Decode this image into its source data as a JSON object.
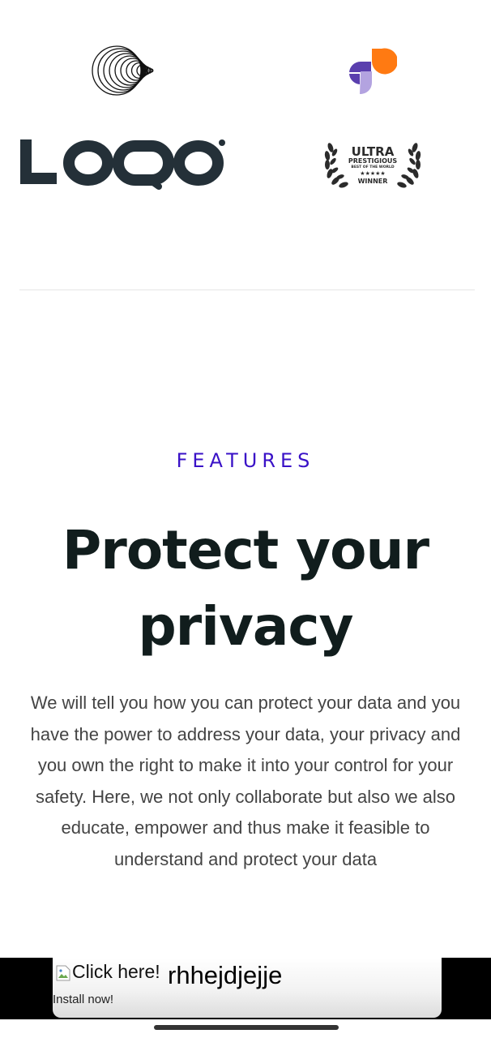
{
  "logos": [
    {
      "name": "concentric-circles-logo"
    },
    {
      "name": "petal-logo",
      "colors": [
        "#ff7a12",
        "#5a3fae",
        "#b3a3e0"
      ]
    },
    {
      "name": "wordmark-logo",
      "text": "LOQO"
    },
    {
      "name": "award-badge",
      "line1": "ULTRA",
      "line2": "PRESTIGIOUS",
      "line3": "BEST OF THE WORLD",
      "stars": "★★★★★",
      "line4": "WINNER"
    }
  ],
  "features": {
    "eyebrow": "FEATURES",
    "headline_line1": "Protect your",
    "headline_line2": "privacy",
    "body": "We will tell you how you can protect your data and you have the power to address your data, your privacy and you own the right to make it into your control for your safety. Here, we not only collaborate but also we also educate, empower and thus make it feasible to understand and protect your data"
  },
  "ad": {
    "image_alt": "Click here!",
    "title": "rhhejdjejje",
    "cta": "Install now!"
  },
  "colors": {
    "accent": "#3a12c7",
    "heading": "#111d1d",
    "body": "#444444",
    "wordmark": "#243038",
    "orange": "#ff7a12",
    "purple": "#5a3fae"
  }
}
